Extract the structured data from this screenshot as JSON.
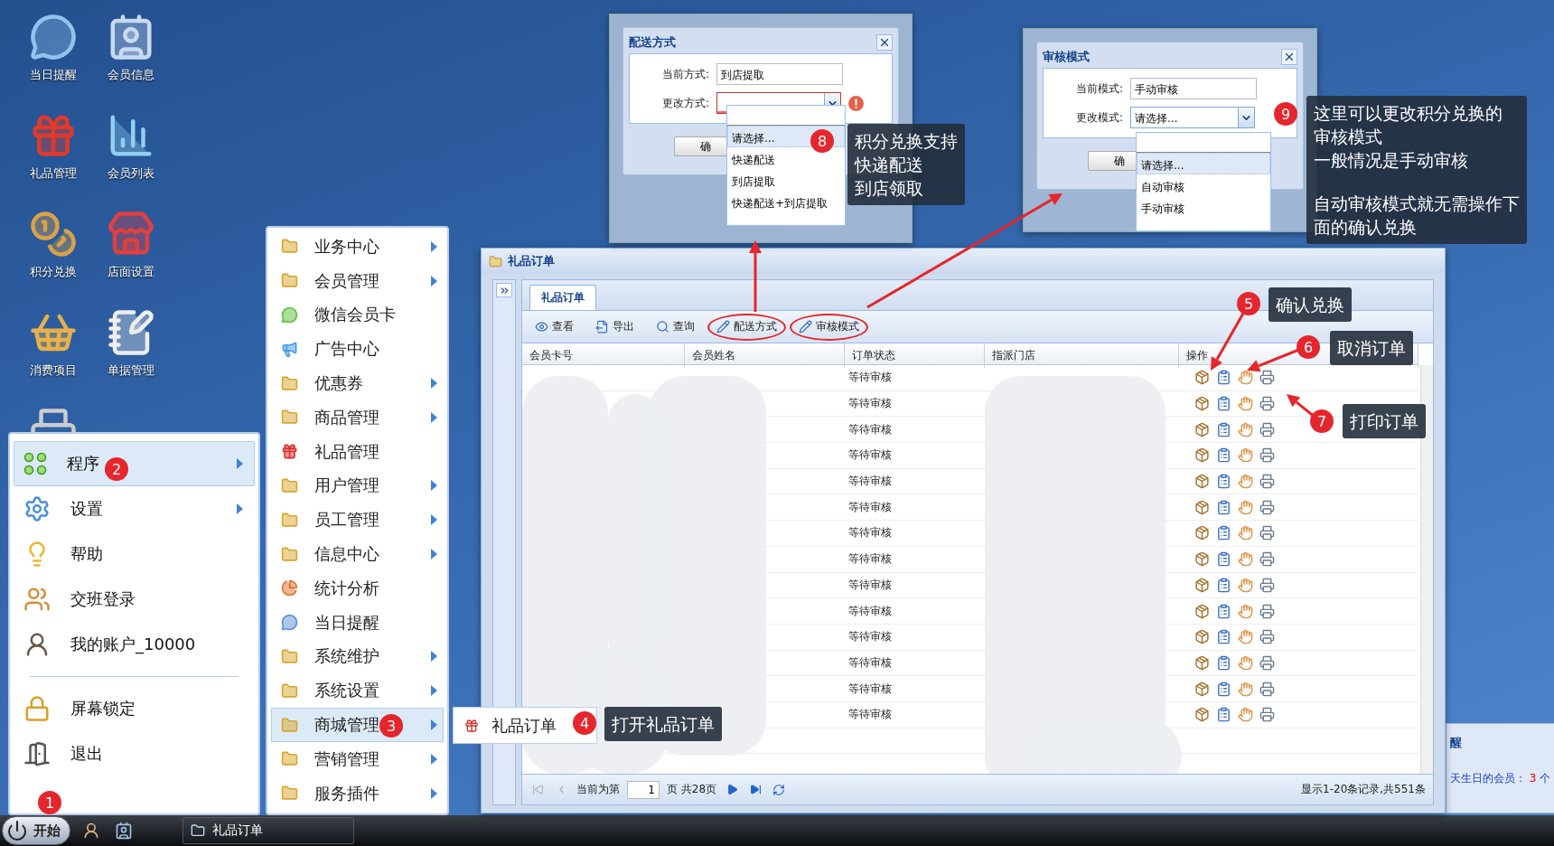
{
  "desktop_icons": [
    {
      "label": "当日提醒"
    },
    {
      "label": "会员信息"
    },
    {
      "label": "礼品管理"
    },
    {
      "label": "会员列表"
    },
    {
      "label": "积分兑换"
    },
    {
      "label": "店面设置"
    },
    {
      "label": "消费项目"
    },
    {
      "label": "单据管理"
    }
  ],
  "dialogs": [
    {
      "title": "配送方式",
      "fields": [
        {
          "label": "当前方式:",
          "value": "到店提取",
          "kind": "text",
          "invalid": false
        },
        {
          "label": "更改方式:",
          "kind": "select",
          "invalid": true
        }
      ],
      "button": "确",
      "options": [
        {
          "label": "请选择...",
          "selected": true
        },
        {
          "label": "快递配送",
          "selected": false
        },
        {
          "label": "到店提取",
          "selected": false
        },
        {
          "label": "快递配送+到店提取",
          "selected": false
        }
      ]
    },
    {
      "title": "审核模式",
      "fields": [
        {
          "label": "当前模式:",
          "value": "手动审核",
          "kind": "text",
          "invalid": false
        },
        {
          "label": "更改模式:",
          "value": "请选择...",
          "kind": "select",
          "invalid": false
        }
      ],
      "button": "确",
      "options": [
        {
          "label": "请选择...",
          "selected": true
        },
        {
          "label": "自动审核",
          "selected": false
        },
        {
          "label": "手动审核",
          "selected": false
        }
      ]
    }
  ],
  "main_window": {
    "title": "礼品订单",
    "tabs": [
      {
        "label": "礼品订单",
        "selected": true
      }
    ],
    "toolbar": [
      {
        "label": "查看",
        "circled": false
      },
      {
        "label": "导出",
        "circled": false
      },
      {
        "label": "查询",
        "circled": false
      },
      {
        "label": "配送方式",
        "circled": true
      },
      {
        "label": "审核模式",
        "circled": true
      }
    ],
    "columns": [
      "会员卡号",
      "会员姓名",
      "订单状态",
      "指派门店",
      "操作"
    ],
    "rows": [
      {
        "status": "等待审核"
      },
      {
        "status": "等待审核"
      },
      {
        "status": "等待审核"
      },
      {
        "status": "等待审核"
      },
      {
        "status": "等待审核"
      },
      {
        "status": "等待审核"
      },
      {
        "status": "等待审核"
      },
      {
        "status": "等待审核"
      },
      {
        "status": "等待审核"
      },
      {
        "status": "等待审核"
      },
      {
        "status": "等待审核"
      },
      {
        "status": "等待审核"
      },
      {
        "status": "等待审核"
      },
      {
        "status": "等待审核"
      }
    ],
    "pager": {
      "prefix": "当前为第",
      "page": "1",
      "suffix": "页 共28页",
      "summary": "显示1-20条记录,共551条"
    }
  },
  "start_menu": {
    "items": [
      {
        "label": "程序",
        "selected": true,
        "submenu": true
      },
      {
        "label": "设置",
        "selected": false,
        "submenu": true
      },
      {
        "label": "帮助",
        "selected": false,
        "submenu": false
      },
      {
        "label": "交班登录",
        "selected": false,
        "submenu": false
      },
      {
        "label": "我的账户_10000",
        "selected": false,
        "submenu": false
      }
    ],
    "bottom_items": [
      {
        "label": "屏幕锁定",
        "selected": false
      },
      {
        "label": "退出",
        "selected": false
      }
    ]
  },
  "programs_menu": [
    {
      "label": "业务中心",
      "kind": "folder",
      "submenu": true,
      "selected": false
    },
    {
      "label": "会员管理",
      "kind": "folder",
      "submenu": true,
      "selected": false
    },
    {
      "label": "微信会员卡",
      "kind": "wechat",
      "submenu": false,
      "selected": false
    },
    {
      "label": "广告中心",
      "kind": "ad",
      "submenu": false,
      "selected": false
    },
    {
      "label": "优惠券",
      "kind": "folder",
      "submenu": true,
      "selected": false
    },
    {
      "label": "商品管理",
      "kind": "folder",
      "submenu": true,
      "selected": false
    },
    {
      "label": "礼品管理",
      "kind": "gift",
      "submenu": false,
      "selected": false
    },
    {
      "label": "用户管理",
      "kind": "folder",
      "submenu": true,
      "selected": false
    },
    {
      "label": "员工管理",
      "kind": "folder",
      "submenu": true,
      "selected": false
    },
    {
      "label": "信息中心",
      "kind": "folder",
      "submenu": true,
      "selected": false
    },
    {
      "label": "统计分析",
      "kind": "chart",
      "submenu": false,
      "selected": false
    },
    {
      "label": "当日提醒",
      "kind": "reminder",
      "submenu": false,
      "selected": false
    },
    {
      "label": "系统维护",
      "kind": "folder",
      "submenu": true,
      "selected": false
    },
    {
      "label": "系统设置",
      "kind": "folder",
      "submenu": true,
      "selected": false
    },
    {
      "label": "商城管理",
      "kind": "folder",
      "submenu": true,
      "selected": true
    },
    {
      "label": "营销管理",
      "kind": "folder",
      "submenu": true,
      "selected": false
    },
    {
      "label": "服务插件",
      "kind": "folder",
      "submenu": true,
      "selected": false
    }
  ],
  "mall_menu": [
    {
      "label": "礼品订单"
    }
  ],
  "callouts": [
    {
      "number": "1"
    },
    {
      "number": "2"
    },
    {
      "number": "3"
    },
    {
      "number": "4",
      "paragraphs": [
        [
          "打开礼品订单"
        ]
      ]
    },
    {
      "number": "5",
      "paragraphs": [
        [
          "确认兑换"
        ]
      ]
    },
    {
      "number": "6",
      "paragraphs": [
        [
          "取消订单"
        ]
      ]
    },
    {
      "number": "7",
      "paragraphs": [
        [
          "打印订单"
        ]
      ]
    },
    {
      "number": "8",
      "paragraphs": [
        [
          "积分兑换支持",
          "快递配送",
          "到店领取"
        ]
      ]
    },
    {
      "number": "9",
      "paragraphs": [
        [
          "这里可以更改积分兑换的",
          "审核模式",
          "一般情况是手动审核"
        ],
        [
          "自动审核模式就无需操作下",
          "面的确认兑换"
        ]
      ]
    }
  ],
  "background_window": {
    "title": "醒",
    "text": "天生日的会员：",
    "count": "3",
    "unit": "个"
  },
  "taskbar": {
    "start": "开始",
    "tasks": [
      {
        "label": "礼品订单"
      }
    ]
  }
}
